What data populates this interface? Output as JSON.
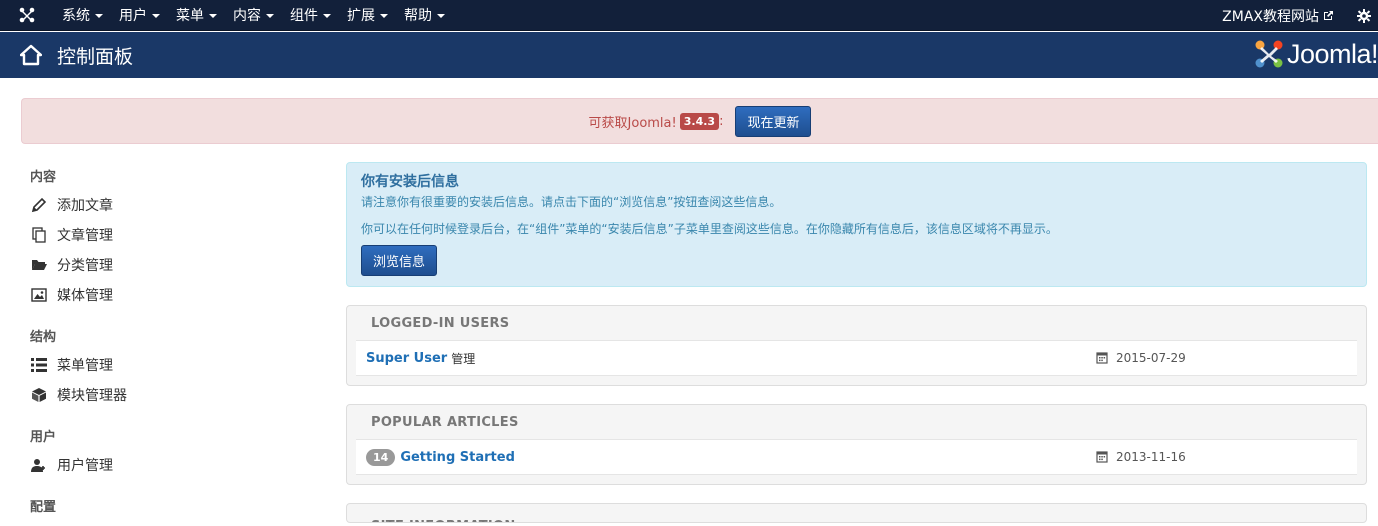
{
  "topnav": {
    "menus": [
      "系统",
      "用户",
      "菜单",
      "内容",
      "组件",
      "扩展",
      "帮助"
    ],
    "site_link": "ZMAX教程网站"
  },
  "header": {
    "title": "控制面板",
    "brand": "Joomla!"
  },
  "update_alert": {
    "message": "可获取Joomla!",
    "version": "3.4.3",
    "colon": ":",
    "button": "现在更新"
  },
  "sidebar": {
    "sections": [
      {
        "heading": "内容",
        "items": [
          {
            "label": "添加文章",
            "icon": "pencil-icon"
          },
          {
            "label": "文章管理",
            "icon": "stack-icon"
          },
          {
            "label": "分类管理",
            "icon": "folder-icon"
          },
          {
            "label": "媒体管理",
            "icon": "image-icon"
          }
        ]
      },
      {
        "heading": "结构",
        "items": [
          {
            "label": "菜单管理",
            "icon": "list-icon"
          },
          {
            "label": "模块管理器",
            "icon": "cube-icon"
          }
        ]
      },
      {
        "heading": "用户",
        "items": [
          {
            "label": "用户管理",
            "icon": "users-icon"
          }
        ]
      },
      {
        "heading": "配置",
        "items": []
      }
    ]
  },
  "postinstall": {
    "title": "你有安装后信息",
    "line1": "请注意你有很重要的安装后信息。请点击下面的“浏览信息”按钮查阅这些信息。",
    "line2": "你可以在任何时候登录后台，在“组件”菜单的“安装后信息”子菜单里查阅这些信息。在你隐藏所有信息后，该信息区域将不再显示。",
    "button": "浏览信息"
  },
  "logged_in": {
    "heading": "LOGGED-IN USERS",
    "rows": [
      {
        "name": "Super User",
        "role": "管理",
        "date": "2015-07-29"
      }
    ]
  },
  "popular": {
    "heading": "POPULAR ARTICLES",
    "rows": [
      {
        "hits": "14",
        "title": "Getting Started",
        "date": "2013-11-16"
      }
    ]
  },
  "site_info": {
    "heading": "SITE INFORMATION"
  },
  "colors": {
    "topnav": "#12203a",
    "header": "#1a3867",
    "alert_bg": "#f2dede",
    "info_bg": "#d9edf7",
    "link": "#1f6fb5"
  }
}
